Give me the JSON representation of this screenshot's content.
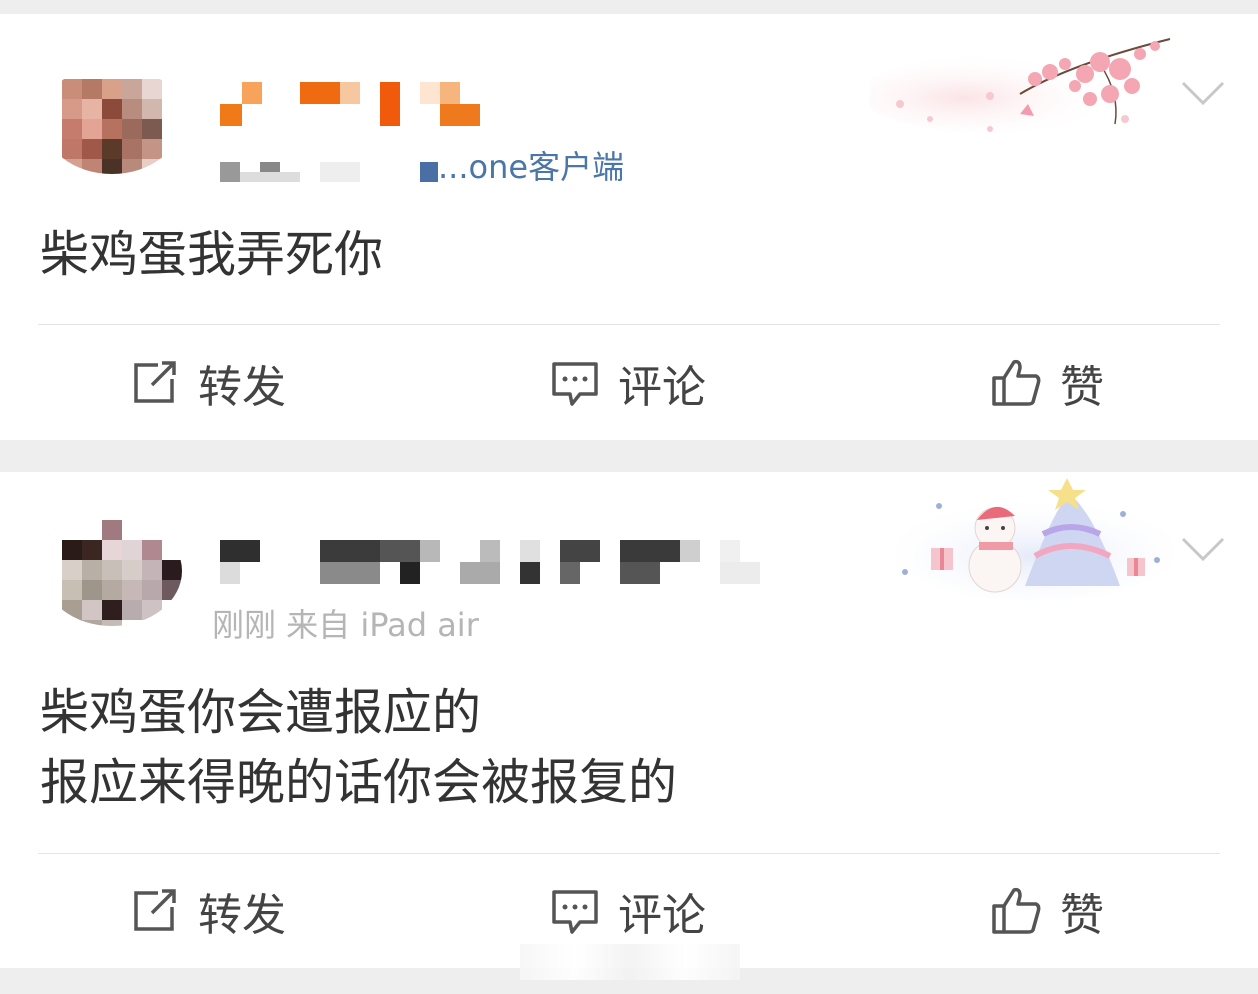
{
  "posts": [
    {
      "source_text": "...one客户端",
      "content_lines": [
        "柴鸡蛋我弄死你"
      ],
      "actions": {
        "repost": "转发",
        "comment": "评论",
        "like": "赞"
      }
    },
    {
      "time_source": "刚刚  来自 iPad air",
      "content_lines": [
        "柴鸡蛋你会遭报应的",
        "报应来得晚的话你会被报复的"
      ],
      "actions": {
        "repost": "转发",
        "comment": "评论",
        "like": "赞"
      }
    }
  ],
  "icons": {
    "repost": "repost-icon",
    "comment": "comment-icon",
    "like": "thumbs-up-icon",
    "menu": "chevron-down-icon"
  },
  "colors": {
    "background": "#eeeeee",
    "card": "#ffffff",
    "source_link": "#4a76a8",
    "text": "#333333",
    "icon": "#555555"
  }
}
